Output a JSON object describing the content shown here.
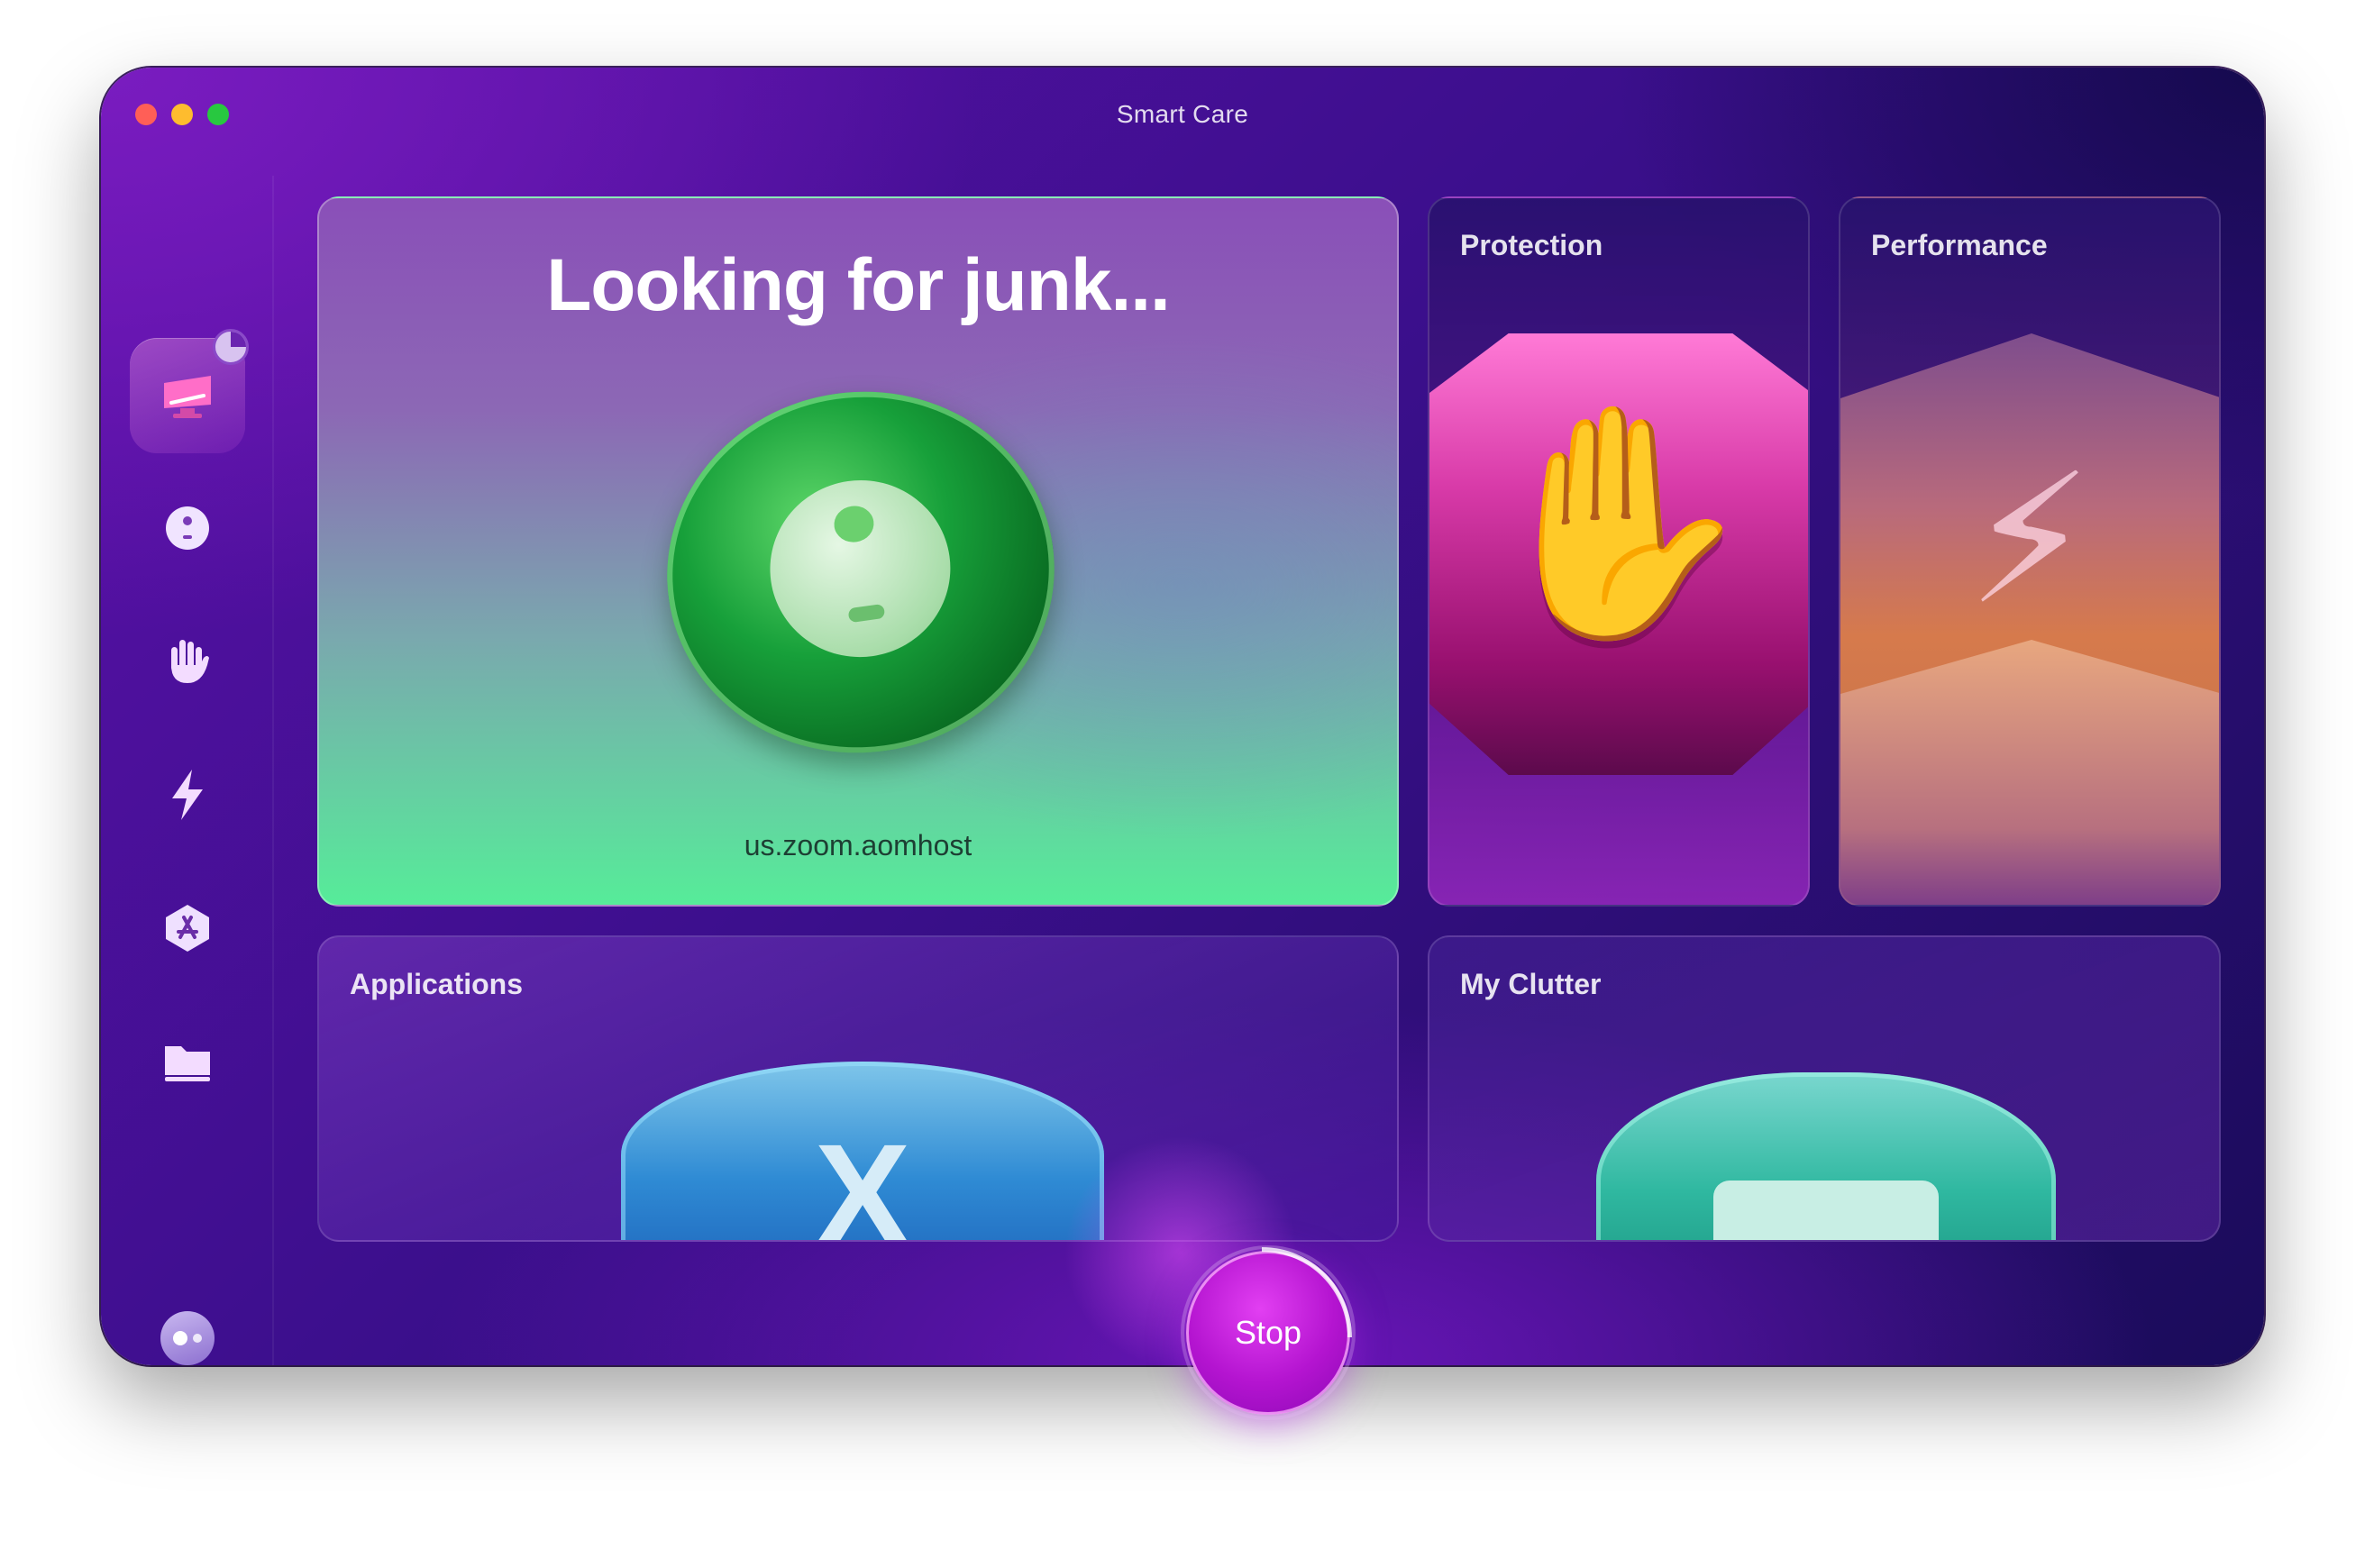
{
  "window": {
    "title": "Smart Care"
  },
  "sidebar": {
    "items": [
      {
        "icon": "smart-care-icon",
        "active": true
      },
      {
        "icon": "cleanup-icon"
      },
      {
        "icon": "protection-icon"
      },
      {
        "icon": "performance-icon"
      },
      {
        "icon": "applications-icon"
      },
      {
        "icon": "my-clutter-icon"
      }
    ],
    "account_icon": "assistant-icon"
  },
  "main_card": {
    "headline": "Looking for junk...",
    "current_item": "us.zoom.aomhost"
  },
  "cards": {
    "protection": "Protection",
    "performance": "Performance",
    "applications": "Applications",
    "my_clutter": "My Clutter"
  },
  "stop_button": {
    "label": "Stop"
  }
}
